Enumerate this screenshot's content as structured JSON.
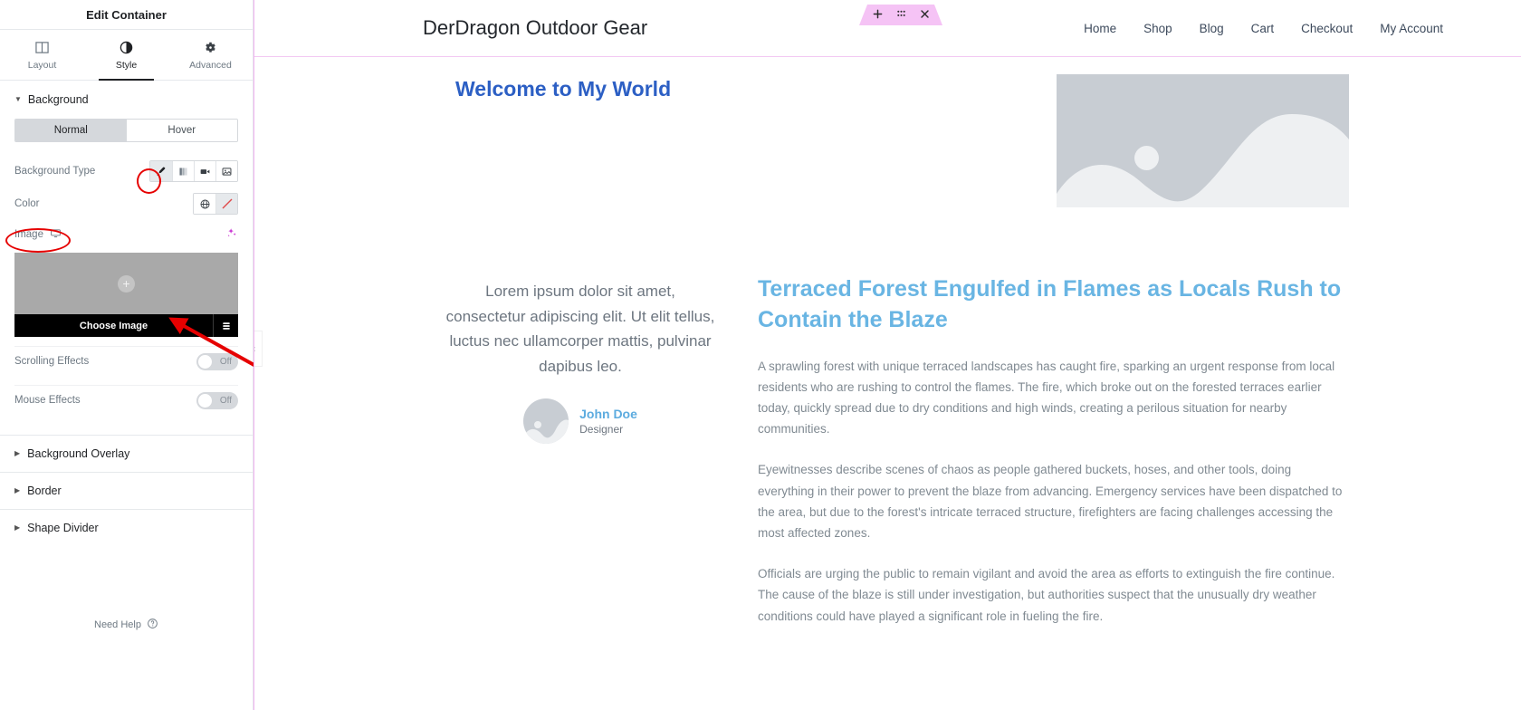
{
  "panel": {
    "title": "Edit Container",
    "tabs": [
      {
        "label": "Layout",
        "icon": "layout-columns-icon",
        "active": false
      },
      {
        "label": "Style",
        "icon": "half-circle-icon",
        "active": true
      },
      {
        "label": "Advanced",
        "icon": "gear-icon",
        "active": false
      }
    ],
    "background_section": {
      "label": "Background",
      "state_tabs": {
        "normal": "Normal",
        "hover": "Hover",
        "selected": "Normal"
      },
      "background_type": {
        "label": "Background Type",
        "options": [
          "classic-brush-icon",
          "gradient-icon",
          "video-icon",
          "slideshow-icon"
        ],
        "selected": "classic-brush-icon"
      },
      "color": {
        "label": "Color",
        "options": [
          "globe-icon",
          "no-color-slash-icon"
        ],
        "selected": "no-color-slash-icon"
      },
      "image": {
        "label": "Image",
        "device_icon": "desktop-icon",
        "ai_icon": "ai-sparkle-icon",
        "choose_label": "Choose Image",
        "library_icon": "media-library-icon",
        "add_icon": "plus-icon"
      },
      "scrolling_effects": {
        "label": "Scrolling Effects",
        "value": "Off"
      },
      "mouse_effects": {
        "label": "Mouse Effects",
        "value": "Off"
      }
    },
    "accordions": [
      {
        "label": "Background Overlay"
      },
      {
        "label": "Border"
      },
      {
        "label": "Shape Divider"
      }
    ],
    "need_help": {
      "label": "Need Help",
      "icon": "question-circle-icon"
    },
    "collapse_handle_icon": "chevron-left-icon"
  },
  "canvas": {
    "site": {
      "brand": "DerDragon Outdoor Gear",
      "nav": [
        "Home",
        "Shop",
        "Blog",
        "Cart",
        "Checkout",
        "My Account"
      ]
    },
    "edit_bar": {
      "add_icon": "plus-icon",
      "drag_icon": "drag-handle-icon",
      "close_icon": "close-icon"
    },
    "heading": "Welcome to My World",
    "hero_image_alt": "image-placeholder",
    "testimonial": {
      "quote": "Lorem ipsum dolor sit amet, consectetur adipiscing elit. Ut elit tellus, luctus nec ullamcorper mattis, pulvinar dapibus leo.",
      "name": "John Doe",
      "role": "Designer"
    },
    "article": {
      "title": "Terraced Forest Engulfed in Flames as Locals Rush to Contain the Blaze",
      "paragraphs": [
        "A sprawling forest with unique terraced landscapes has caught fire, sparking an urgent response from local residents who are rushing to control the flames. The fire, which broke out on the forested terraces earlier today, quickly spread due to dry conditions and high winds, creating a perilous situation for nearby communities.",
        "Eyewitnesses describe scenes of chaos as people gathered buckets, hoses, and other tools, doing everything in their power to prevent the blaze from advancing. Emergency services have been dispatched to the area, but due to the forest's intricate terraced structure, firefighters are facing challenges accessing the most affected zones.",
        "Officials are urging the public to remain vigilant and avoid the area as efforts to extinguish the fire continue. The cause of the blaze is still under investigation, but authorities suspect that the unusually dry weather conditions could have played a significant role in fueling the fire."
      ]
    }
  },
  "colors": {
    "heading_blue": "#2c5fc4",
    "article_blue": "#69b5e3",
    "annotation_red": "#e60000",
    "editor_pink": "#f5c3f5",
    "panel_border": "#e6e9ec"
  }
}
